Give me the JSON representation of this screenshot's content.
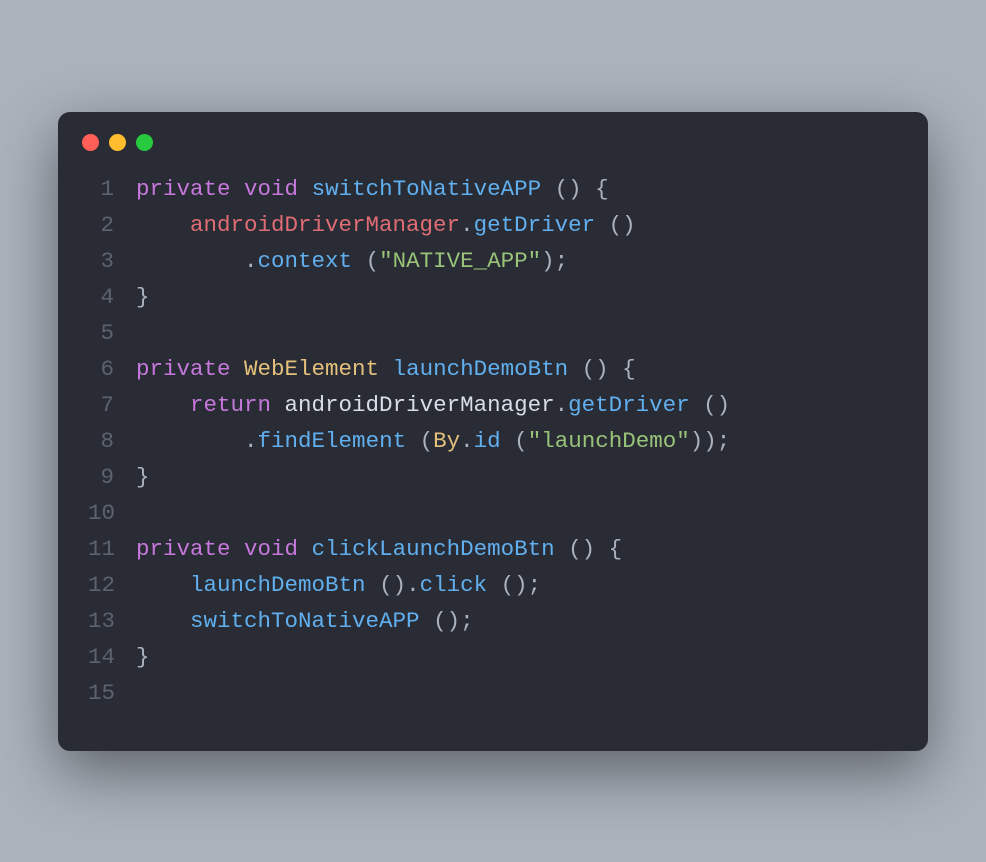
{
  "window": {
    "dots": [
      "red",
      "yellow",
      "green"
    ]
  },
  "code": {
    "lines": [
      {
        "n": "1",
        "tokens": [
          {
            "t": "private",
            "c": "kw"
          },
          {
            "t": " ",
            "c": "plain"
          },
          {
            "t": "void",
            "c": "kw"
          },
          {
            "t": " ",
            "c": "plain"
          },
          {
            "t": "switchToNativeAPP",
            "c": "fn"
          },
          {
            "t": " ",
            "c": "plain"
          },
          {
            "t": "()",
            "c": "punct"
          },
          {
            "t": " ",
            "c": "plain"
          },
          {
            "t": "{",
            "c": "punct"
          }
        ]
      },
      {
        "n": "2",
        "tokens": [
          {
            "t": "    ",
            "c": "plain"
          },
          {
            "t": "androidDriverManager",
            "c": "var"
          },
          {
            "t": ".",
            "c": "punct"
          },
          {
            "t": "getDriver",
            "c": "fn"
          },
          {
            "t": " ",
            "c": "plain"
          },
          {
            "t": "()",
            "c": "punct"
          }
        ]
      },
      {
        "n": "3",
        "tokens": [
          {
            "t": "        ",
            "c": "plain"
          },
          {
            "t": ".",
            "c": "punct"
          },
          {
            "t": "context",
            "c": "fn"
          },
          {
            "t": " ",
            "c": "plain"
          },
          {
            "t": "(",
            "c": "punct"
          },
          {
            "t": "\"NATIVE_APP\"",
            "c": "str"
          },
          {
            "t": ")",
            "c": "punct"
          },
          {
            "t": ";",
            "c": "punct"
          }
        ]
      },
      {
        "n": "4",
        "tokens": [
          {
            "t": "}",
            "c": "punct"
          }
        ]
      },
      {
        "n": "5",
        "tokens": []
      },
      {
        "n": "6",
        "tokens": [
          {
            "t": "private",
            "c": "kw"
          },
          {
            "t": " ",
            "c": "plain"
          },
          {
            "t": "WebElement",
            "c": "type"
          },
          {
            "t": " ",
            "c": "plain"
          },
          {
            "t": "launchDemoBtn",
            "c": "fn"
          },
          {
            "t": " ",
            "c": "plain"
          },
          {
            "t": "()",
            "c": "punct"
          },
          {
            "t": " ",
            "c": "plain"
          },
          {
            "t": "{",
            "c": "punct"
          }
        ]
      },
      {
        "n": "7",
        "tokens": [
          {
            "t": "    ",
            "c": "plain"
          },
          {
            "t": "return",
            "c": "ret"
          },
          {
            "t": " ",
            "c": "plain"
          },
          {
            "t": "androidDriverManager",
            "c": "plain"
          },
          {
            "t": ".",
            "c": "punct"
          },
          {
            "t": "getDriver",
            "c": "fn"
          },
          {
            "t": " ",
            "c": "plain"
          },
          {
            "t": "()",
            "c": "punct"
          }
        ]
      },
      {
        "n": "8",
        "tokens": [
          {
            "t": "        ",
            "c": "plain"
          },
          {
            "t": ".",
            "c": "punct"
          },
          {
            "t": "findElement",
            "c": "fn"
          },
          {
            "t": " ",
            "c": "plain"
          },
          {
            "t": "(",
            "c": "punct"
          },
          {
            "t": "By",
            "c": "type"
          },
          {
            "t": ".",
            "c": "punct"
          },
          {
            "t": "id",
            "c": "fn"
          },
          {
            "t": " ",
            "c": "plain"
          },
          {
            "t": "(",
            "c": "punct"
          },
          {
            "t": "\"launchDemo\"",
            "c": "str"
          },
          {
            "t": "))",
            "c": "punct"
          },
          {
            "t": ";",
            "c": "punct"
          }
        ]
      },
      {
        "n": "9",
        "tokens": [
          {
            "t": "}",
            "c": "punct"
          }
        ]
      },
      {
        "n": "10",
        "tokens": []
      },
      {
        "n": "11",
        "tokens": [
          {
            "t": "private",
            "c": "kw"
          },
          {
            "t": " ",
            "c": "plain"
          },
          {
            "t": "void",
            "c": "kw"
          },
          {
            "t": " ",
            "c": "plain"
          },
          {
            "t": "clickLaunchDemoBtn",
            "c": "fn"
          },
          {
            "t": " ",
            "c": "plain"
          },
          {
            "t": "()",
            "c": "punct"
          },
          {
            "t": " ",
            "c": "plain"
          },
          {
            "t": "{",
            "c": "punct"
          }
        ]
      },
      {
        "n": "12",
        "tokens": [
          {
            "t": "    ",
            "c": "plain"
          },
          {
            "t": "launchDemoBtn",
            "c": "fn"
          },
          {
            "t": " ",
            "c": "plain"
          },
          {
            "t": "()",
            "c": "punct"
          },
          {
            "t": ".",
            "c": "punct"
          },
          {
            "t": "click",
            "c": "fn"
          },
          {
            "t": " ",
            "c": "plain"
          },
          {
            "t": "()",
            "c": "punct"
          },
          {
            "t": ";",
            "c": "punct"
          }
        ]
      },
      {
        "n": "13",
        "tokens": [
          {
            "t": "    ",
            "c": "plain"
          },
          {
            "t": "switchToNativeAPP",
            "c": "fn"
          },
          {
            "t": " ",
            "c": "plain"
          },
          {
            "t": "()",
            "c": "punct"
          },
          {
            "t": ";",
            "c": "punct"
          }
        ]
      },
      {
        "n": "14",
        "tokens": [
          {
            "t": "}",
            "c": "punct"
          }
        ]
      },
      {
        "n": "15",
        "tokens": []
      }
    ]
  }
}
